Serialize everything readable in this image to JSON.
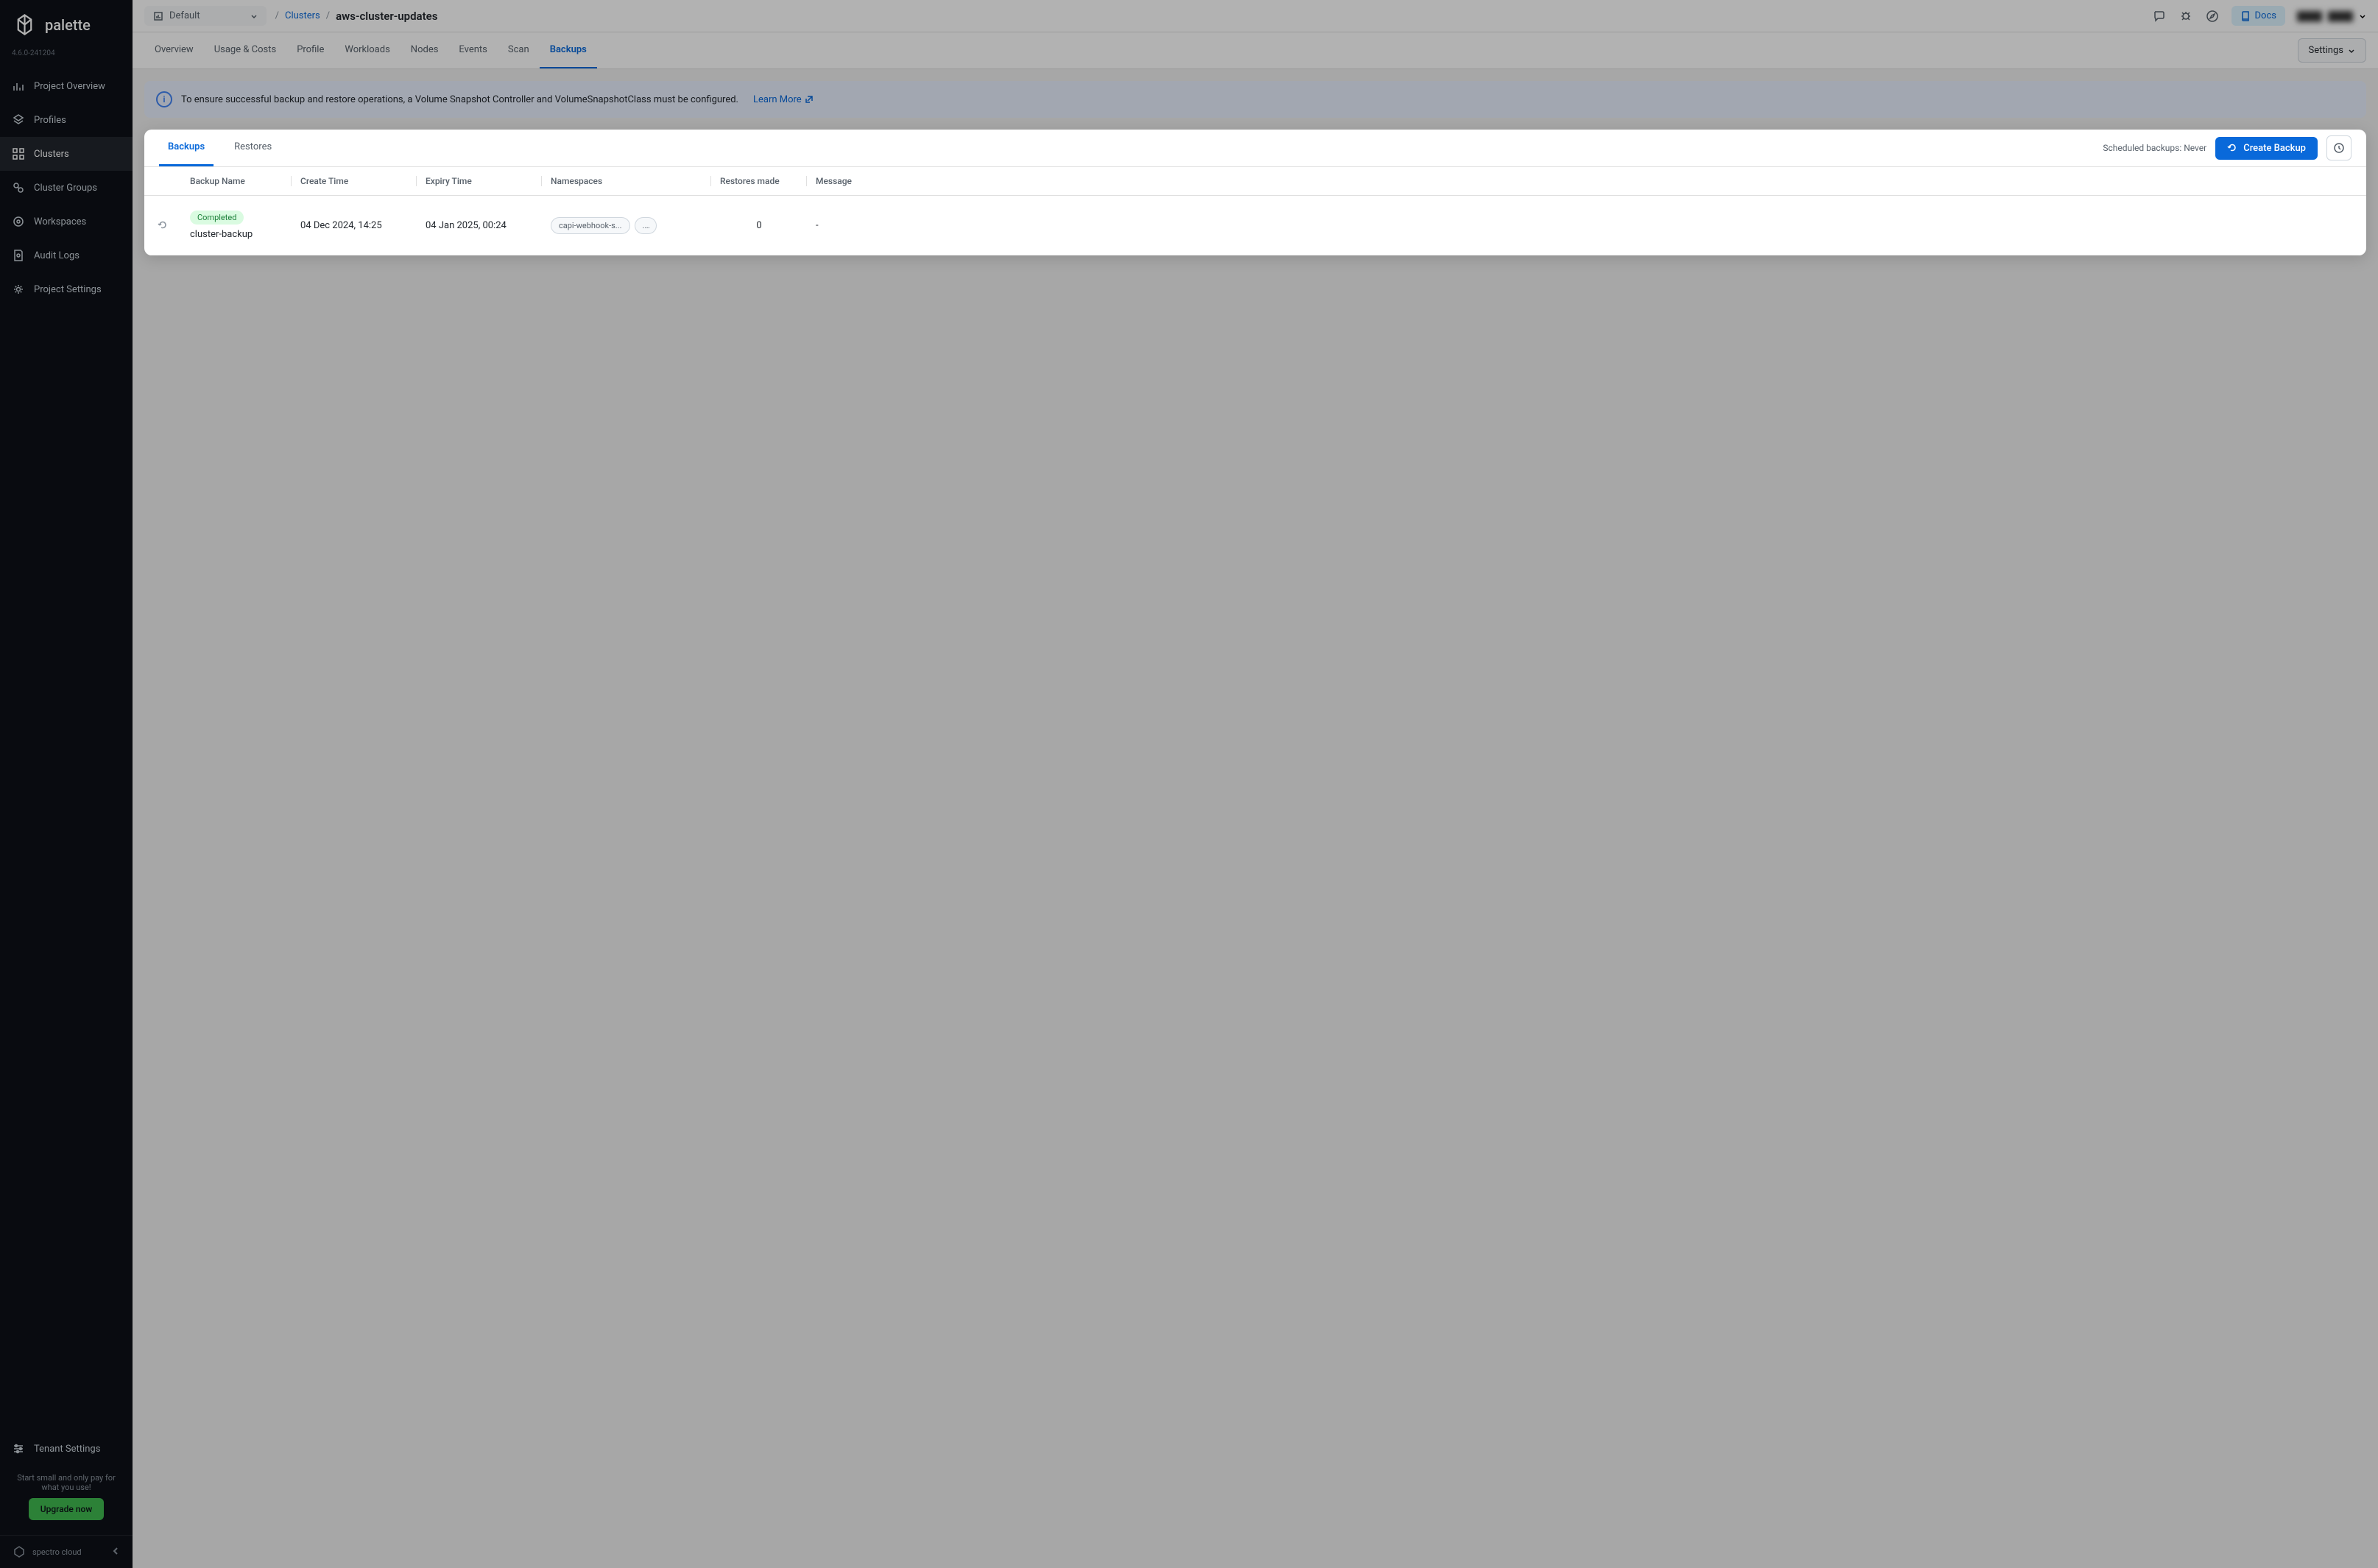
{
  "brand": {
    "name": "palette",
    "version": "4.6.0-241204",
    "footer": "spectro cloud"
  },
  "sidebar": {
    "items": [
      {
        "label": "Project Overview",
        "icon": "chart"
      },
      {
        "label": "Profiles",
        "icon": "layers"
      },
      {
        "label": "Clusters",
        "icon": "grid",
        "active": true
      },
      {
        "label": "Cluster Groups",
        "icon": "group"
      },
      {
        "label": "Workspaces",
        "icon": "target"
      },
      {
        "label": "Audit Logs",
        "icon": "file"
      },
      {
        "label": "Project Settings",
        "icon": "gear"
      }
    ],
    "tenant": {
      "label": "Tenant Settings"
    },
    "upgrade": {
      "text": "Start small and only pay for what you use!",
      "button": "Upgrade now"
    }
  },
  "header": {
    "project_selector": "Default",
    "breadcrumb": {
      "parent": "Clusters",
      "current": "aws-cluster-updates"
    },
    "docs": "Docs",
    "user_name": "████",
    "user_handle": "████"
  },
  "tabs": [
    "Overview",
    "Usage & Costs",
    "Profile",
    "Workloads",
    "Nodes",
    "Events",
    "Scan",
    "Backups"
  ],
  "active_tab": "Backups",
  "settings_btn": "Settings",
  "alert": {
    "text": "To ensure successful backup and restore operations, a Volume Snapshot Controller and VolumeSnapshotClass must be configured.",
    "link": "Learn More"
  },
  "panel": {
    "tabs": [
      "Backups",
      "Restores"
    ],
    "active_tab": "Backups",
    "scheduled_text": "Scheduled backups: Never",
    "create_button": "Create Backup",
    "columns": [
      "",
      "Backup Name",
      "Create Time",
      "Expiry Time",
      "Namespaces",
      "Restores made",
      "Message"
    ],
    "rows": [
      {
        "status": "Completed",
        "name": "cluster-backup",
        "create_time": "04 Dec 2024, 14:25",
        "expiry_time": "04 Jan 2025, 00:24",
        "namespace": "capi-webhook-s...",
        "namespace_more": "...",
        "restores": "0",
        "message": "-"
      }
    ]
  }
}
